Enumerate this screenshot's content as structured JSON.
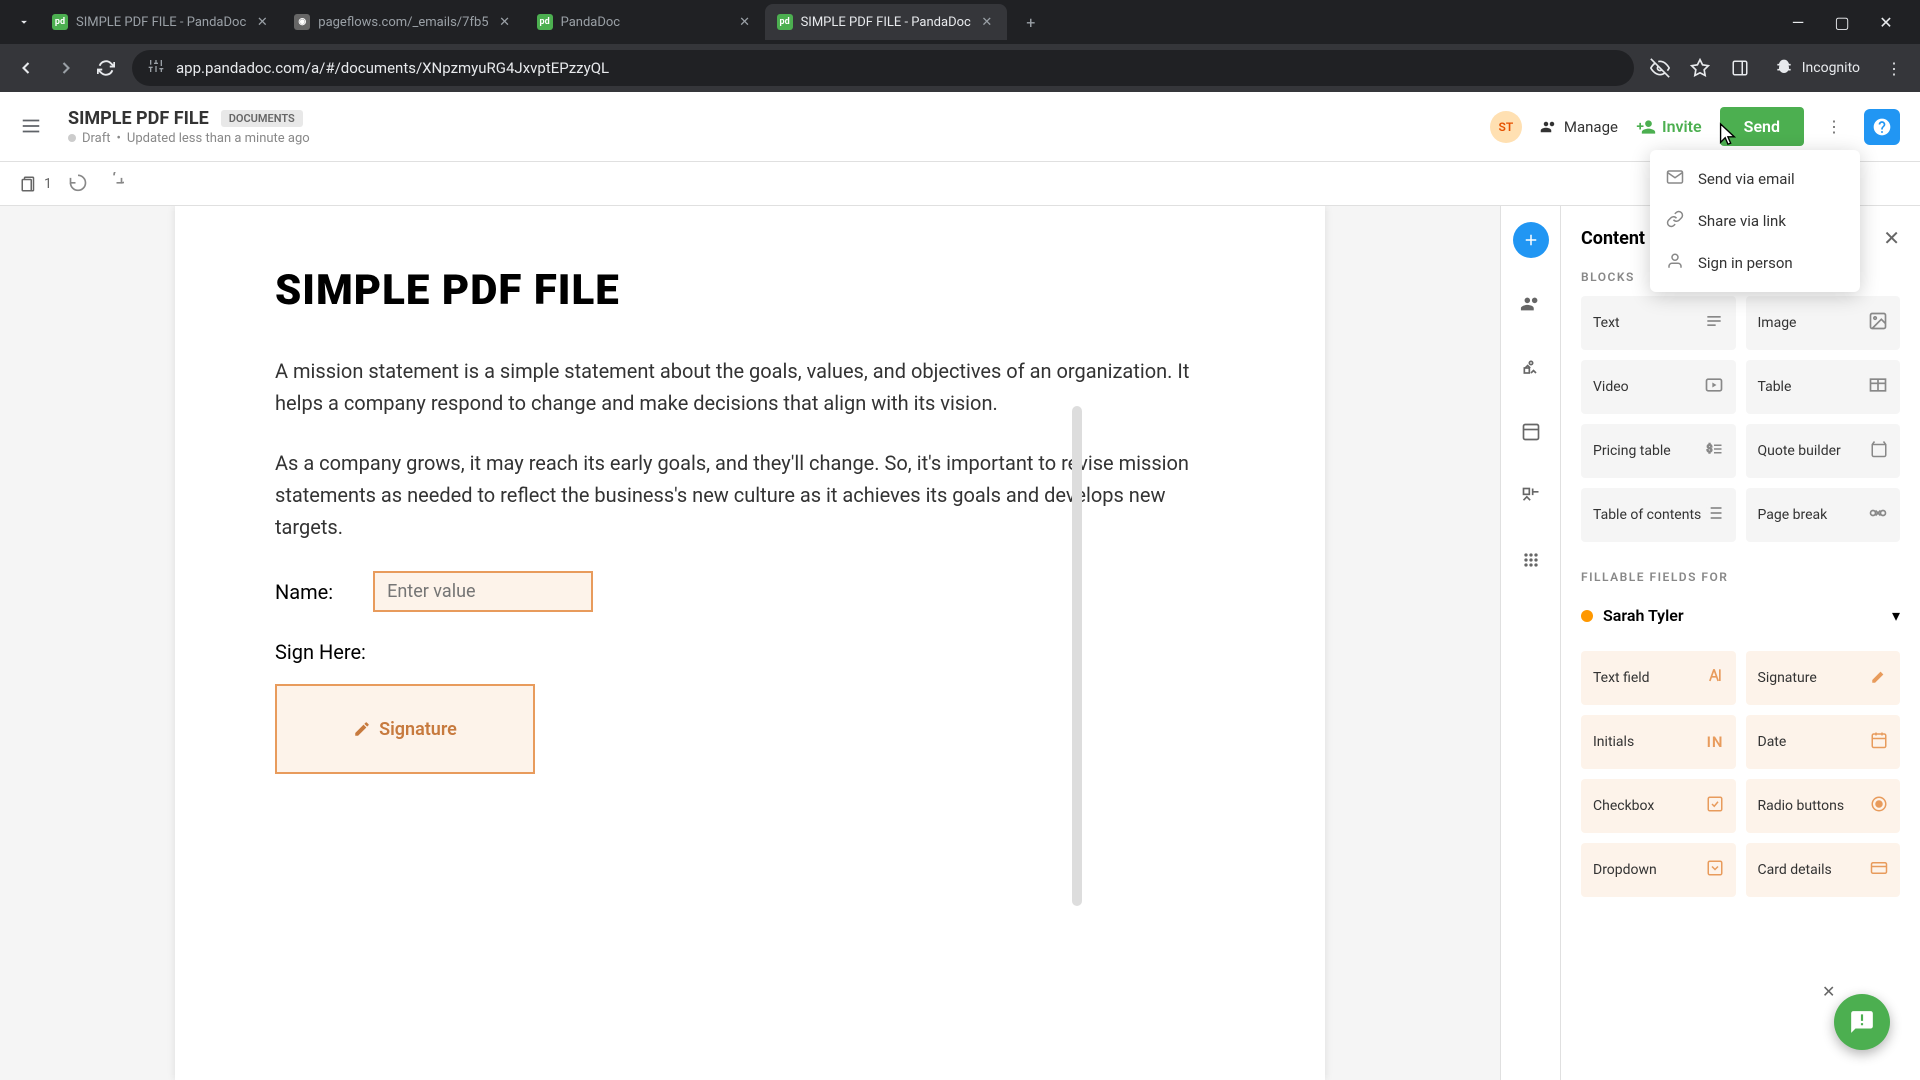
{
  "browser": {
    "tabs": [
      {
        "title": "SIMPLE PDF FILE - PandaDoc",
        "active": false
      },
      {
        "title": "pageflows.com/_emails/7fb5",
        "active": false
      },
      {
        "title": "PandaDoc",
        "active": false
      },
      {
        "title": "SIMPLE PDF FILE - PandaDoc",
        "active": true
      }
    ],
    "url": "app.pandadoc.com/a/#/documents/XNpzmyuRG4JxvptEPzzyQL",
    "incognito_label": "Incognito"
  },
  "header": {
    "doc_title": "SIMPLE PDF FILE",
    "badge": "DOCUMENTS",
    "status": "Draft",
    "updated": "Updated less than a minute ago",
    "avatar_initials": "ST",
    "manage": "Manage",
    "invite": "Invite",
    "send": "Send"
  },
  "toolbar": {
    "page_count": "1"
  },
  "document": {
    "heading": "SIMPLE PDF FILE",
    "para1": "A mission statement is a simple statement about the goals, values, and objectives of an organization. It helps a company respond to change and make decisions that align with its vision.",
    "para2": "As a company grows, it may reach its early goals, and they'll change. So, it's important to revise mission statements as needed to reflect the business's new culture as it achieves its goals and develops new targets.",
    "name_label": "Name:",
    "name_placeholder": "Enter value",
    "sign_label": "Sign Here:",
    "signature_label": "Signature"
  },
  "send_menu": {
    "email": "Send via email",
    "link": "Share via link",
    "in_person": "Sign in person"
  },
  "panel": {
    "title": "Content",
    "blocks_label": "BLOCKS",
    "blocks": {
      "text": "Text",
      "image": "Image",
      "video": "Video",
      "table": "Table",
      "pricing": "Pricing table",
      "quote": "Quote builder",
      "toc": "Table of contents",
      "pagebreak": "Page break"
    },
    "fillable_label": "FILLABLE FIELDS FOR",
    "recipient": "Sarah Tyler",
    "fields": {
      "text_field": "Text field",
      "signature": "Signature",
      "initials": "Initials",
      "date": "Date",
      "checkbox": "Checkbox",
      "radio": "Radio buttons",
      "dropdown": "Dropdown",
      "card": "Card details"
    }
  }
}
